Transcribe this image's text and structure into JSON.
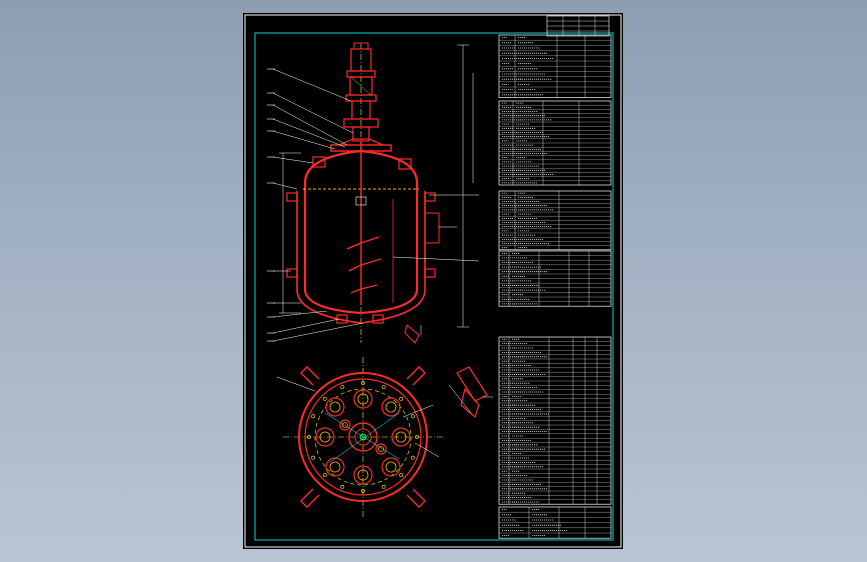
{
  "title_block": {
    "rows": [
      "",
      "",
      "",
      ""
    ]
  },
  "colors": {
    "background_top": "#8e9db2",
    "background_bottom": "#bac5d3",
    "sheet": "#000000",
    "frame": "#ffffff",
    "inner_border": "#00ffff",
    "vessel": "#ff2a2a",
    "centerline": "#ffff00",
    "dimension": "#ffffff",
    "nozzle_green": "#00ff66"
  },
  "icons": {
    "vessel_elevation": "reactor-vessel-elevation",
    "vessel_plan": "reactor-vessel-plan-view",
    "detail": "support-bracket-detail"
  }
}
